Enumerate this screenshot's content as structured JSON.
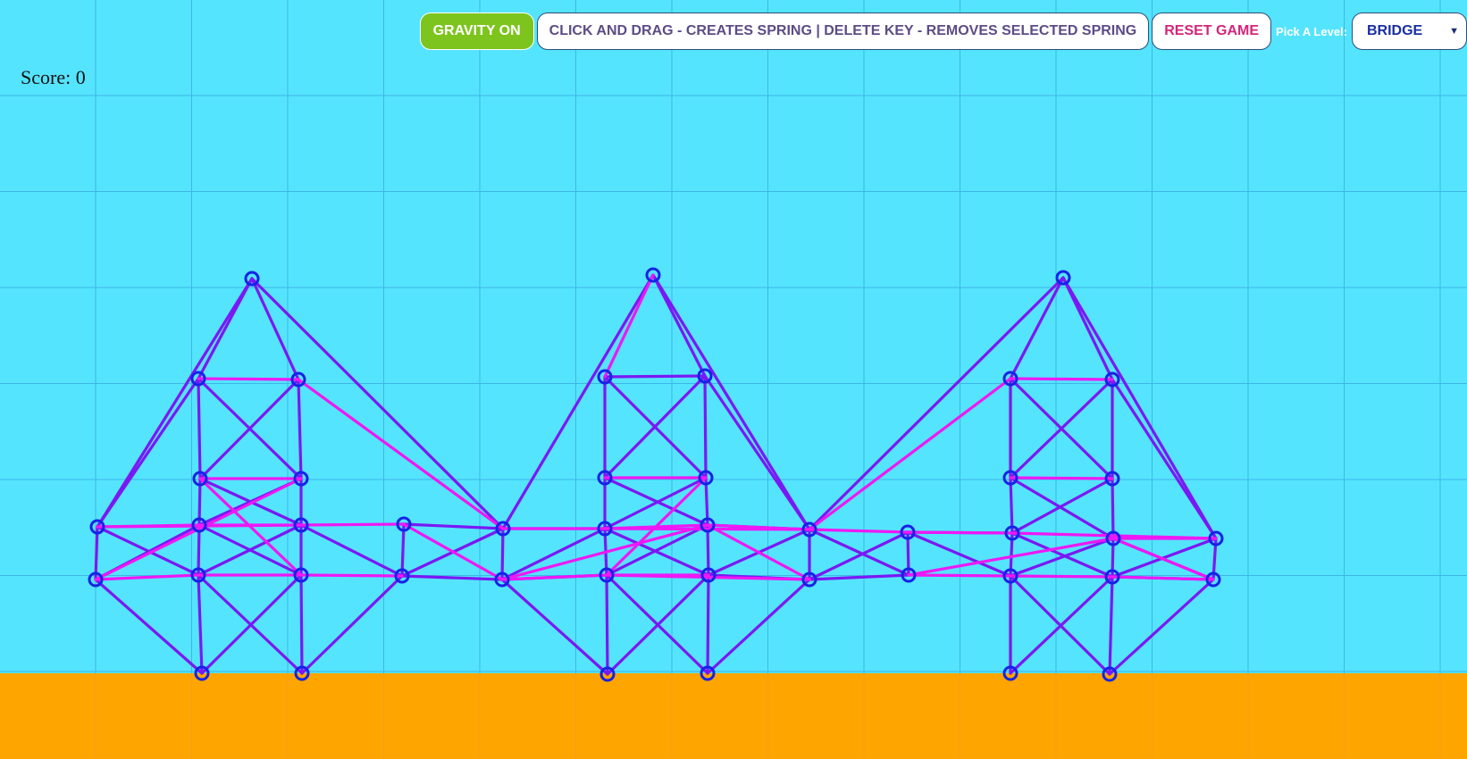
{
  "toolbar": {
    "gravity_label": "GRAVITY ON",
    "instructions": "CLICK AND DRAG - CREATES SPRING | DELETE KEY - REMOVES SELECTED SPRING",
    "reset_label": "RESET GAME",
    "pick_level_label": "Pick A Level:",
    "level_selected": "BRIDGE"
  },
  "score": {
    "label": "Score: 0"
  },
  "colors": {
    "sky": "#55e4fe",
    "ground": "#ffa500",
    "grid": "#3cb6e8",
    "spring": "#7a18f4",
    "selected_spring": "#ee18f4",
    "node": "#1523e6"
  },
  "icons": {
    "select": "chevron-down-icon"
  }
}
